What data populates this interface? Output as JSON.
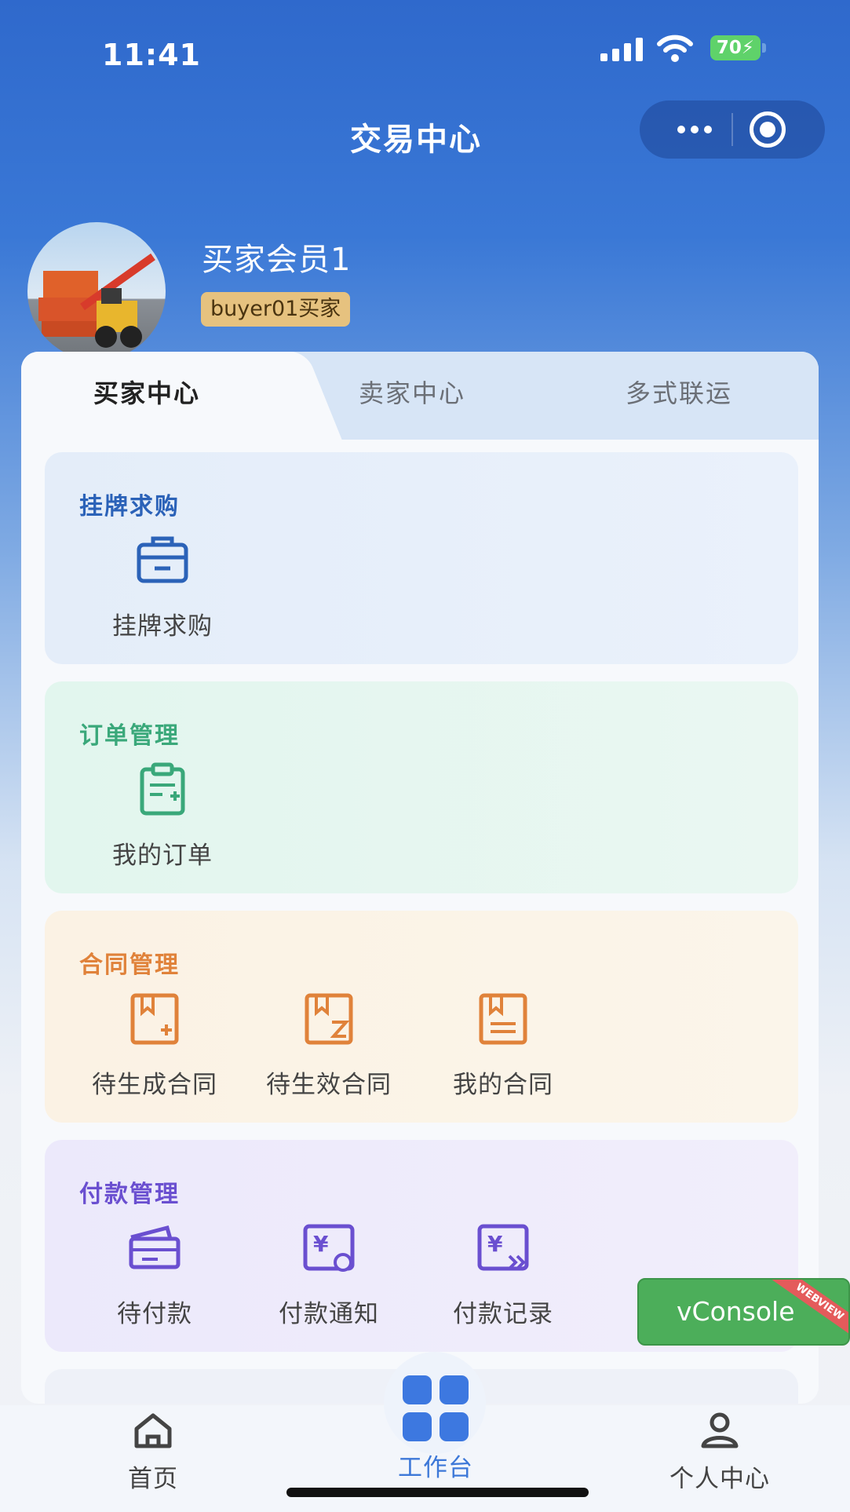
{
  "status_bar": {
    "time": "11:41",
    "battery": "70"
  },
  "nav": {
    "title": "交易中心"
  },
  "profile": {
    "name": "买家会员1",
    "badge": "buyer01买家"
  },
  "tabs": [
    {
      "label": "买家中心",
      "active": true
    },
    {
      "label": "卖家中心",
      "active": false
    },
    {
      "label": "多式联运",
      "active": false
    }
  ],
  "sections": [
    {
      "title": "挂牌求购",
      "color": "#2b62b8",
      "items": [
        {
          "label": "挂牌求购",
          "icon": "briefcase-icon"
        }
      ]
    },
    {
      "title": "订单管理",
      "color": "#3aa87a",
      "items": [
        {
          "label": "我的订单",
          "icon": "clipboard-add-icon"
        }
      ]
    },
    {
      "title": "合同管理",
      "color": "#e0823a",
      "items": [
        {
          "label": "待生成合同",
          "icon": "contract-add-icon"
        },
        {
          "label": "待生效合同",
          "icon": "contract-pending-icon"
        },
        {
          "label": "我的合同",
          "icon": "contract-icon"
        }
      ]
    },
    {
      "title": "付款管理",
      "color": "#6a4fd0",
      "items": [
        {
          "label": "待付款",
          "icon": "wallet-icon"
        },
        {
          "label": "付款通知",
          "icon": "payment-notice-icon"
        },
        {
          "label": "付款记录",
          "icon": "payment-record-icon"
        }
      ]
    }
  ],
  "vconsole": {
    "label": "vConsole",
    "ribbon": "WEBVIEW"
  },
  "tabbar": [
    {
      "label": "首页",
      "icon": "home-icon"
    },
    {
      "label": "工作台",
      "icon": "grid-icon",
      "active": true
    },
    {
      "label": "个人中心",
      "icon": "user-icon"
    }
  ],
  "colors": {
    "primary": "#3d78e0",
    "header": "#2f69cc"
  }
}
